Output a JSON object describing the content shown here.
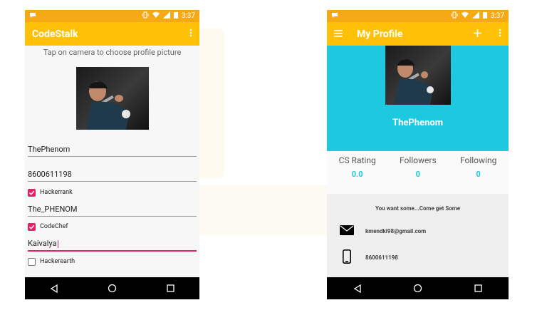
{
  "left": {
    "status": {
      "time": "3:37"
    },
    "appbar": {
      "title": "CodeStalk"
    },
    "hint": "Tap on camera to choose profile picture",
    "fields": {
      "name": "ThePhenom",
      "phone": "8600611198",
      "hackerrank_label": "Hackerrank",
      "hackerrank_user": "The_PHENOM",
      "codechef_label": "CodeChef",
      "codechef_user": "Kaivalya",
      "hackerearth_label": "Hackerearth"
    },
    "checks": {
      "hackerrank": true,
      "codechef": true,
      "hackerearth": false
    }
  },
  "right": {
    "status": {
      "time": "3:37"
    },
    "appbar": {
      "title": "My Profile"
    },
    "profile_name": "ThePhenom",
    "stats": [
      {
        "label": "CS Rating",
        "value": "0.0"
      },
      {
        "label": "Followers",
        "value": "0"
      },
      {
        "label": "Following",
        "value": "0"
      }
    ],
    "tagline": "You want some...Come get Some",
    "email": "kmendki98@gmail.com",
    "phone": "8600611198"
  },
  "colors": {
    "status_bar": "#f5a915",
    "app_bar": "#ffc107",
    "accent": "#e91e63",
    "profile_header": "#1ec9e0"
  },
  "icons": [
    "chat-bubble-icon",
    "vibrate-icon",
    "wifi-icon",
    "signal-icon",
    "battery-icon",
    "overflow-menu-icon",
    "hamburger-menu-icon",
    "add-icon",
    "mail-icon",
    "phone-icon",
    "back-nav-icon",
    "home-nav-icon",
    "recents-nav-icon"
  ]
}
